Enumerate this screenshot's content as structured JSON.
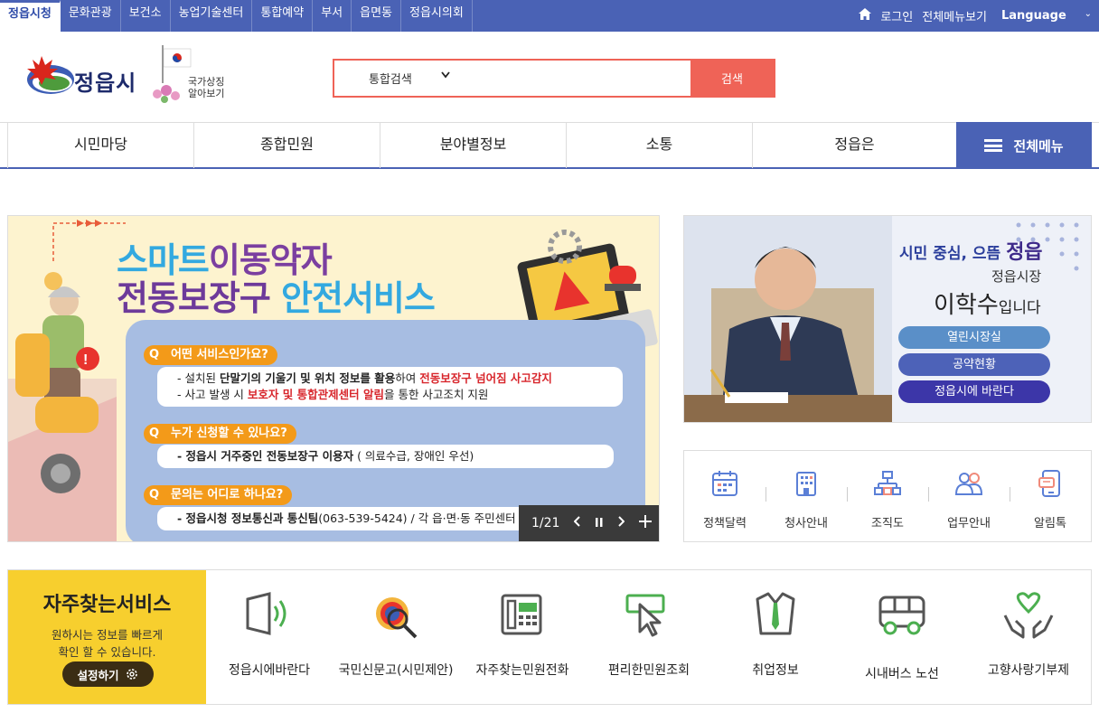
{
  "topbar": {
    "tabs": [
      "정읍시청",
      "문화관광",
      "보건소",
      "농업기술센터",
      "통합예약",
      "부서",
      "읍면동",
      "정읍시의회"
    ],
    "login": "로그인",
    "all_menu": "전체메뉴보기",
    "language": "Language"
  },
  "header": {
    "logo_text": "정읍시",
    "symbol_line1": "국가상징",
    "symbol_line2": "알아보기",
    "search_scope": "통합검색",
    "search_button": "검색",
    "search_value": ""
  },
  "gnb": {
    "items": [
      "시민마당",
      "종합민원",
      "분야별정보",
      "소통",
      "정읍은"
    ],
    "all_menu": "전체메뉴"
  },
  "banner": {
    "title_part1": "스마트",
    "title_part2": "이동약자",
    "title2_part1": "전동보장구",
    "title2_part2": "안전서비스",
    "q1": "어떤 서비스인가요?",
    "a1_l1_a": "- 설치된 ",
    "a1_l1_b": "단말기의 기울기 및 위치 정보를 활용",
    "a1_l1_c": "하여 ",
    "a1_l1_d": "전동보장구 넘어짐 사고감지",
    "a1_l2_a": "- 사고 발생 시 ",
    "a1_l2_b": "보호자 및 통합관제센터 알림",
    "a1_l2_c": "을 통한 사고조치 지원",
    "q2": "누가 신청할 수 있나요?",
    "a2_a": "- 정읍시 거주중인 전동보장구 이용자",
    "a2_b": " ( 의료수급, 장애인 우선)",
    "q3": "문의는 어디로 하나요?",
    "a3_a": "- 정읍시청 정보통신과 통신팀",
    "a3_b": "(063-539-5424) / 각 읍·면·동 주민센터",
    "counter": "1/21"
  },
  "mayor": {
    "slogan_a": "시민 중심, 으뜸 ",
    "slogan_b": "정읍",
    "role": "정읍시장",
    "name": "이학수",
    "name_suffix": "입니다",
    "btn1": "열린시장실",
    "btn2": "공약현황",
    "btn3": "정읍시에 바란다"
  },
  "quick_links": [
    "정책달력",
    "청사안내",
    "조직도",
    "업무안내",
    "알림톡"
  ],
  "frequent": {
    "title": "자주찾는서비스",
    "desc_l1": "원하시는 정보를 빠르게",
    "desc_l2": "확인 할 수 있습니다.",
    "setting": "설정하기",
    "items": [
      "정읍시에바란다",
      "국민신문고(시민제안)",
      "자주찾는민원전화",
      "편리한민원조회",
      "취업정보",
      "시내버스 노선",
      "고향사랑기부제"
    ]
  },
  "colors": {
    "primary": "#4a62b5",
    "accent": "#ef6357",
    "yellow": "#f7cf2e"
  }
}
